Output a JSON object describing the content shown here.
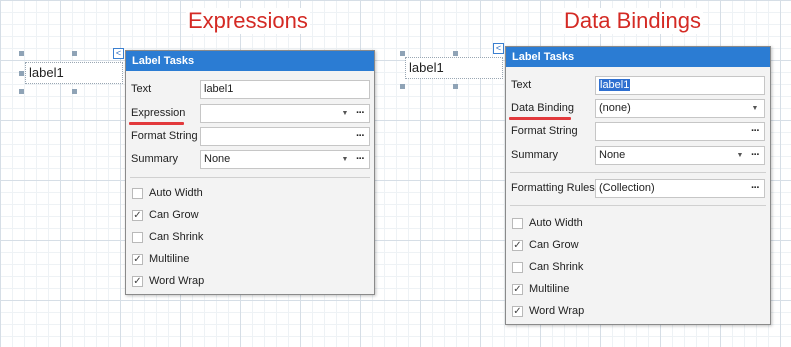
{
  "headings": {
    "left": "Expressions",
    "right": "Data Bindings"
  },
  "left_label": "label1",
  "right_label": "label1",
  "smart_tag_glyph": "<",
  "left_panel": {
    "title": "Label Tasks",
    "text_label": "Text",
    "text_value": "label1",
    "expression_label": "Expression",
    "expression_value": "",
    "format_label": "Format String",
    "format_value": "",
    "summary_label": "Summary",
    "summary_value": "None",
    "checks": [
      {
        "label": "Auto Width",
        "checked": false
      },
      {
        "label": "Can Grow",
        "checked": true
      },
      {
        "label": "Can Shrink",
        "checked": false
      },
      {
        "label": "Multiline",
        "checked": true
      },
      {
        "label": "Word Wrap",
        "checked": true
      }
    ]
  },
  "right_panel": {
    "title": "Label Tasks",
    "text_label": "Text",
    "text_value": "label1",
    "binding_label": "Data Binding",
    "binding_value": "(none)",
    "format_label": "Format String",
    "format_value": "",
    "summary_label": "Summary",
    "summary_value": "None",
    "rules_label": "Formatting Rules",
    "rules_value": "(Collection)",
    "checks": [
      {
        "label": "Auto Width",
        "checked": false
      },
      {
        "label": "Can Grow",
        "checked": true
      },
      {
        "label": "Can Shrink",
        "checked": false
      },
      {
        "label": "Multiline",
        "checked": true
      },
      {
        "label": "Word Wrap",
        "checked": true
      }
    ]
  },
  "glyphs": {
    "ellipsis": "···",
    "caret": "▼",
    "check": "✓"
  },
  "colors": {
    "accent": "#2b7cd3",
    "heading": "#d42a24",
    "underline": "#e2393c"
  }
}
